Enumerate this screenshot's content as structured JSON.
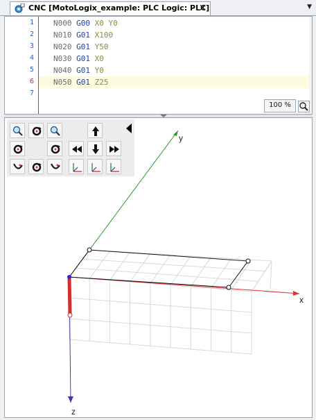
{
  "tab": {
    "title": "CNC [MotoLogix_example: PLC Logic: PLC]",
    "close_glyph": "×",
    "menu_glyph": "▼"
  },
  "editor": {
    "lines": [
      {
        "num": "1",
        "code": "N000 G00 X0 Y0"
      },
      {
        "num": "2",
        "code": "N010 G01 X100"
      },
      {
        "num": "3",
        "code": "N020 G01 Y50"
      },
      {
        "num": "4",
        "code": "N030 G01 X0"
      },
      {
        "num": "5",
        "code": "N040 G01 Y0"
      },
      {
        "num": "6",
        "code": "N050 G01 Z25"
      },
      {
        "num": "7",
        "code": ""
      }
    ],
    "active_line": 6,
    "zoom": "100 %"
  },
  "view": {
    "axes": {
      "x": "x",
      "y": "y",
      "z": "z"
    },
    "toolbar_icons": [
      "zoom-in-icon",
      "rotate-icon",
      "zoom-out-icon",
      "pan-up-icon",
      "rotate-left-icon",
      "rotate-right-icon",
      "pan-left-icon",
      "pan-down-icon",
      "pan-right-icon",
      "tilt-left-icon",
      "tilt-down-icon",
      "tilt-right-icon",
      "view-xy-icon",
      "view-xz-icon",
      "view-yz-icon"
    ]
  },
  "colors": {
    "x_axis": "#e03030",
    "y_axis": "#2a9a2a",
    "z_axis": "#3a3ab0",
    "tool": "#d03030"
  }
}
